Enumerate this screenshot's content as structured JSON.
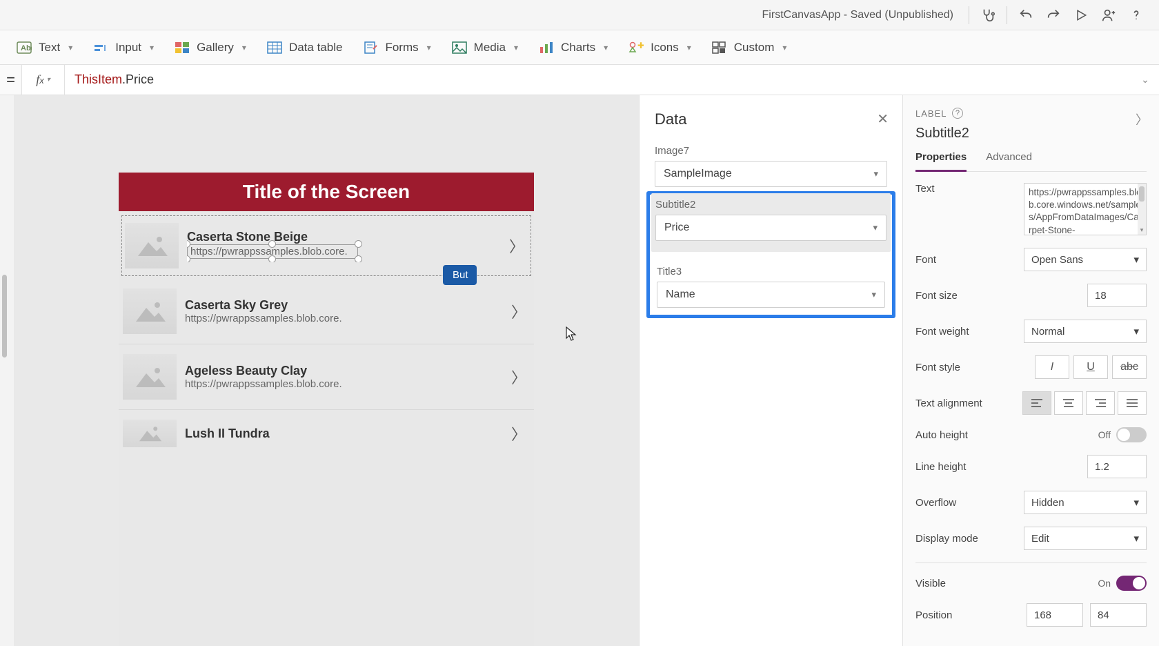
{
  "titlebar": {
    "app_title": "FirstCanvasApp - Saved (Unpublished)"
  },
  "ribbon": {
    "text": "Text",
    "input": "Input",
    "gallery": "Gallery",
    "data_table": "Data table",
    "forms": "Forms",
    "media": "Media",
    "charts": "Charts",
    "icons": "Icons",
    "custom": "Custom"
  },
  "formula": {
    "prefix": "ThisItem",
    "dot": ".",
    "field": "Price"
  },
  "canvas": {
    "screen_title": "Title of the Screen",
    "button_label": "But",
    "items": [
      {
        "title": "Caserta Stone Beige",
        "sub": "https://pwrappssamples.blob.core."
      },
      {
        "title": "Caserta Sky Grey",
        "sub": "https://pwrappssamples.blob.core."
      },
      {
        "title": "Ageless Beauty Clay",
        "sub": "https://pwrappssamples.blob.core."
      },
      {
        "title": "Lush II Tundra",
        "sub": ""
      }
    ]
  },
  "data_pane": {
    "title": "Data",
    "fields": {
      "image_label": "Image7",
      "image_value": "SampleImage",
      "subtitle_label": "Subtitle2",
      "subtitle_value": "Price",
      "title_label": "Title3",
      "title_value": "Name"
    }
  },
  "props": {
    "crumb": "LABEL",
    "name": "Subtitle2",
    "tabs": {
      "properties": "Properties",
      "advanced": "Advanced"
    },
    "rows": {
      "text_label": "Text",
      "text_value": "https://pwrappssamples.blob.core.windows.net/samples/AppFromDataImages/Carpet-Stone-",
      "font_label": "Font",
      "font_value": "Open Sans",
      "font_size_label": "Font size",
      "font_size_value": "18",
      "font_weight_label": "Font weight",
      "font_weight_value": "Normal",
      "font_style_label": "Font style",
      "text_align_label": "Text alignment",
      "auto_height_label": "Auto height",
      "auto_height_value": "Off",
      "line_height_label": "Line height",
      "line_height_value": "1.2",
      "overflow_label": "Overflow",
      "overflow_value": "Hidden",
      "display_mode_label": "Display mode",
      "display_mode_value": "Edit",
      "visible_label": "Visible",
      "visible_value": "On",
      "position_label": "Position",
      "pos_x": "168",
      "pos_y": "84"
    }
  }
}
